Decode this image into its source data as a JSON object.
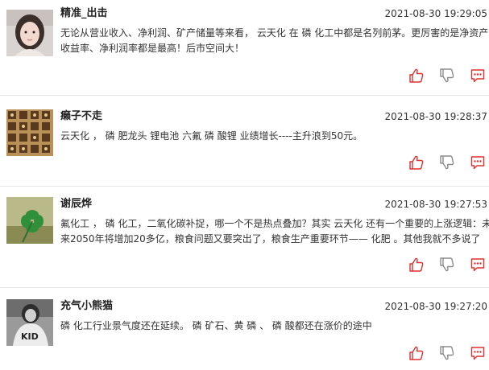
{
  "posts": [
    {
      "username": "精准_出击",
      "time": "2021-08-30 19:29:05",
      "avatar_icon": "user-photo-avatar",
      "lines": [
        "无论从营业收入、净利润、矿产储量等来看， 云天化 在 磷 化工中都是名列前茅。更厉害的是净资产",
        "收益率、净利润率都是最高！后市空间大！"
      ]
    },
    {
      "username": "癞子不走",
      "time": "2021-08-30 19:28:37",
      "avatar_icon": "pattern-avatar",
      "lines": [
        "云天化 ， 磷 肥龙头 锂电池 六氟 磷 酸锂 业绩增长----主升浪到50元。"
      ]
    },
    {
      "username": "谢辰烨",
      "time": "2021-08-30 19:27:53",
      "avatar_icon": "clover-avatar",
      "lines": [
        "氟化工 ， 磷 化工，二氧化碳补捉，哪一个不是热点叠加？其实 云天化 还有一个重要的上涨逻辑：未",
        "来2050年将增加20多亿，粮食问题又要突出了，粮食生产重要环节—— 化肥 。其他我就不多说了"
      ]
    },
    {
      "username": "充气小熊猫",
      "time": "2021-08-30 19:27:20",
      "avatar_icon": "bw-photo-avatar",
      "lines": [
        "磷 化工行业景气度还在延续。 磷 矿石、黄 磷 、 磷 酸都还在涨价的途中"
      ]
    }
  ],
  "icons": {
    "like": "thumbs-up-icon",
    "dislike": "thumbs-down-icon",
    "reply": "comment-icon"
  },
  "colors": {
    "accent": "#e0312f",
    "icon_gray": "#8c8c8c",
    "divider": "#e6e6e6"
  }
}
